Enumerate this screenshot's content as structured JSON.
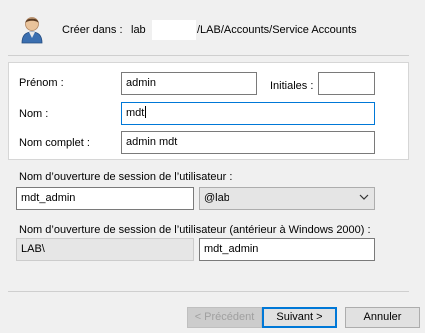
{
  "header": {
    "icon": "user-icon",
    "create_in_label": "Créer dans :",
    "path_prefix": "lab",
    "path_suffix": "/LAB/Accounts/Service Accounts"
  },
  "form": {
    "first_name_label": "Prénom :",
    "first_name_value": "admin",
    "initials_label": "Initiales :",
    "initials_value": "",
    "last_name_label": "Nom :",
    "last_name_value": "mdt",
    "full_name_label": "Nom complet :",
    "full_name_value": "admin mdt",
    "logon_name_label": "Nom d’ouverture de session de l’utilisateur :",
    "logon_name_value": "mdt_admin",
    "domain_suffix_value": "@lab",
    "logon_name_legacy_label": "Nom d’ouverture de session de l’utilisateur (antérieur à Windows 2000) :",
    "legacy_domain_value": "LAB\\",
    "legacy_logon_value": "mdt_admin"
  },
  "buttons": {
    "previous_label": "< Précédent",
    "next_label": "Suivant >",
    "cancel_label": "Annuler"
  },
  "colors": {
    "focus": "#0078d7",
    "background": "#f0f0f0"
  }
}
